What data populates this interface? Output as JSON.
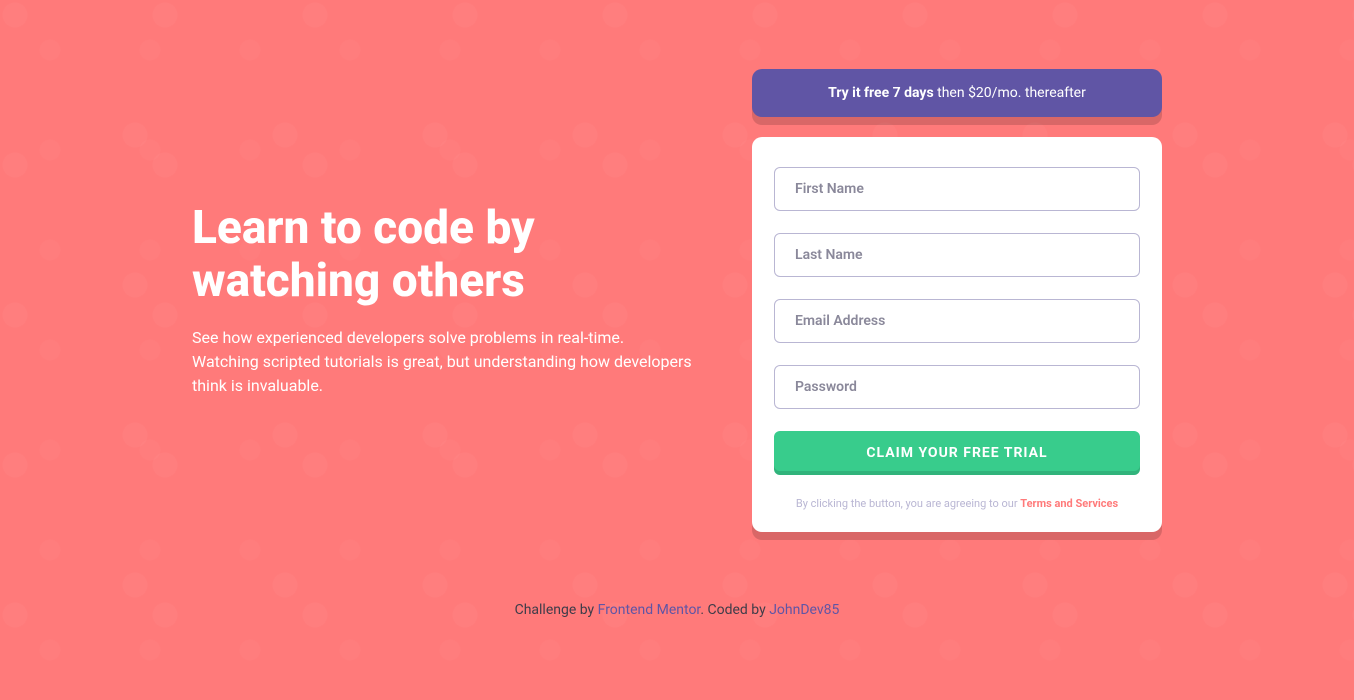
{
  "hero": {
    "heading": "Learn to code by watching others",
    "subheading": "See how experienced developers solve problems in real-time. Watching scripted tutorials is great, but understanding how developers think is invaluable."
  },
  "banner": {
    "bold": "Try it free 7 days",
    "rest": " then $20/mo. thereafter"
  },
  "form": {
    "first_name_placeholder": "First Name",
    "last_name_placeholder": "Last Name",
    "email_placeholder": "Email Address",
    "password_placeholder": "Password",
    "submit_label": "CLAIM YOUR FREE TRIAL",
    "fine_print_prefix": "By clicking the button, you are agreeing to our ",
    "fine_print_link": "Terms and Services"
  },
  "attribution": {
    "challenge_prefix": "Challenge by ",
    "challenge_link": "Frontend Mentor",
    "coded_prefix": ".   Coded by ",
    "coded_link": "JohnDev85"
  },
  "colors": {
    "primary_bg": "#ff7a7a",
    "banner_bg": "#6055a5",
    "button_bg": "#38cc8c",
    "text_light": "#ffffff"
  }
}
